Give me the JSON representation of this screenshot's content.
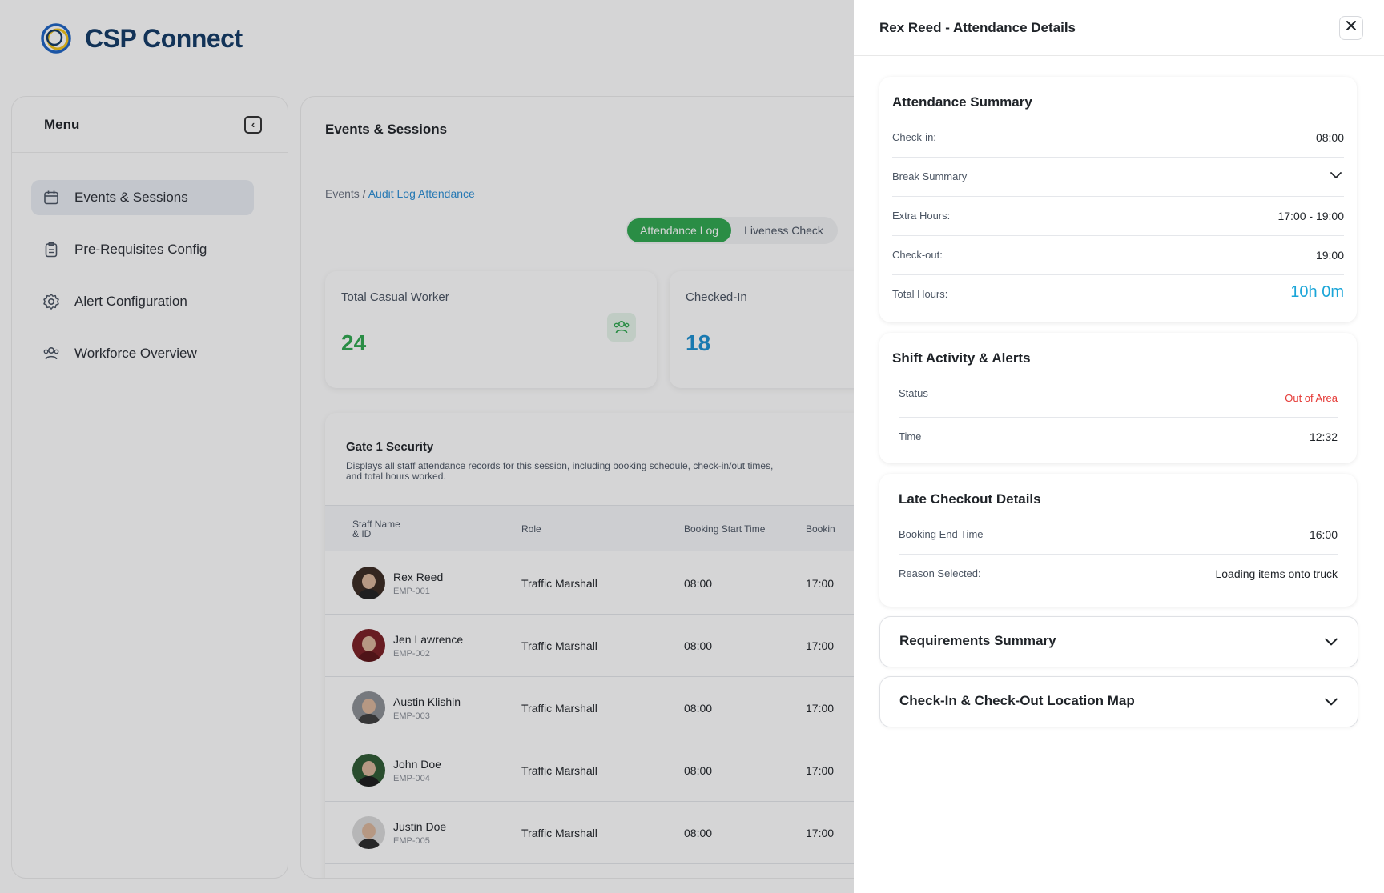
{
  "brand": {
    "name": "CSP Connect"
  },
  "sidebar": {
    "title": "Menu",
    "items": [
      {
        "label": "Events & Sessions",
        "icon": "calendar-icon"
      },
      {
        "label": "Pre-Requisites Config",
        "icon": "clipboard-icon"
      },
      {
        "label": "Alert Configuration",
        "icon": "gear-icon"
      },
      {
        "label": "Workforce Overview",
        "icon": "users-icon"
      }
    ]
  },
  "main": {
    "title": "Events & Sessions",
    "breadcrumb": {
      "root": "Events /",
      "current": "Audit Log Attendance"
    },
    "tabs": [
      "Attendance Log",
      "Liveness Check"
    ],
    "stats": [
      {
        "label": "Total Casual Worker",
        "value": "24",
        "color": "#2fa84f"
      },
      {
        "label": "Checked-In",
        "value": "18",
        "color": "#1a8fd1"
      }
    ],
    "table": {
      "title": "Gate 1 Security",
      "description": "Displays all staff attendance records for this session, including booking schedule, check-in/out times, and total hours worked.",
      "columns": [
        "Staff Name & ID",
        "Role",
        "Booking Start Time",
        "Bookin"
      ],
      "rows": [
        {
          "name": "Rex Reed",
          "id": "EMP-001",
          "role": "Traffic Marshall",
          "start": "08:00",
          "end": "17:00"
        },
        {
          "name": "Jen Lawrence",
          "id": "EMP-002",
          "role": "Traffic Marshall",
          "start": "08:00",
          "end": "17:00"
        },
        {
          "name": "Austin Klishin",
          "id": "EMP-003",
          "role": "Traffic Marshall",
          "start": "08:00",
          "end": "17:00"
        },
        {
          "name": "John Doe",
          "id": "EMP-004",
          "role": "Traffic Marshall",
          "start": "08:00",
          "end": "17:00"
        },
        {
          "name": "Justin Doe",
          "id": "EMP-005",
          "role": "Traffic Marshall",
          "start": "08:00",
          "end": "17:00"
        }
      ]
    }
  },
  "drawer": {
    "title": "Rex Reed - Attendance Details",
    "attendance": {
      "title": "Attendance Summary",
      "check_in_label": "Check-in:",
      "check_in": "08:00",
      "break_label": "Break Summary",
      "extra_label": "Extra Hours:",
      "extra": "17:00 - 19:00",
      "check_out_label": "Check-out:",
      "check_out": "19:00",
      "total_label": "Total Hours:",
      "total": "10h 0m"
    },
    "shift": {
      "title": "Shift Activity & Alerts",
      "status_label": "Status",
      "status": "Out of Area",
      "time_label": "Time",
      "time": "12:32"
    },
    "late": {
      "title": "Late Checkout Details",
      "end_label": "Booking End Time",
      "end": "16:00",
      "reason_label": "Reason Selected:",
      "reason": "Loading items onto truck"
    },
    "requirements_title": "Requirements Summary",
    "map_title": "Check-In & Check-Out Location Map"
  },
  "colors": {
    "accent_green": "#2fa84f",
    "accent_blue": "#1aa5d8",
    "alert_red": "#e53935",
    "brand_navy": "#123a66"
  }
}
